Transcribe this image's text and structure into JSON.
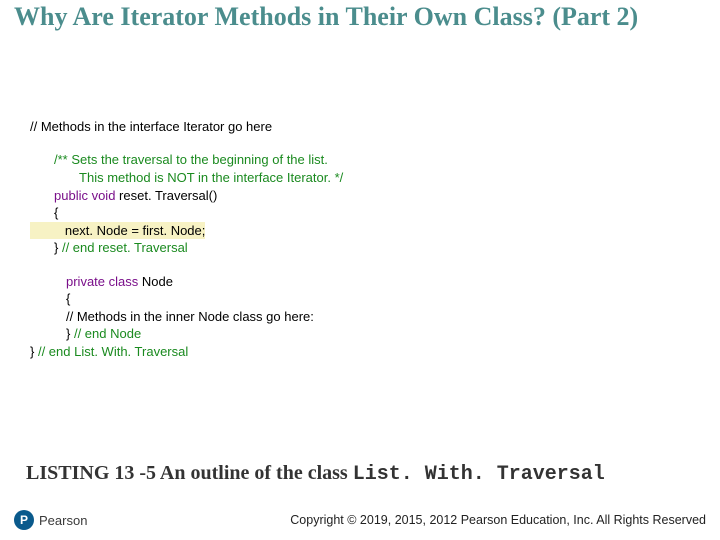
{
  "title": "Why Are Iterator Methods in Their Own Class? (Part 2)",
  "code": {
    "l1": "// Methods in the interface Iterator go here",
    "l2a": "/** Sets the traversal to the beginning of the list.",
    "l2b": "       This method is NOT in the interface Iterator. */",
    "l3_kw": "public void",
    "l3_rest": " reset. Traversal()",
    "l4": "{",
    "l5": "   next. Node = first. Node;",
    "l6a": "} ",
    "l6b": "// end reset. Traversal",
    "l7_kw": "private class",
    "l7_rest": " Node",
    "l8": "{",
    "l9": "// Methods in the inner Node class go here:",
    "l10a": "} ",
    "l10b": "// end Node",
    "l11a": "} ",
    "l11b": "// end List. With. Traversal"
  },
  "listing_prefix": "LISTING 13 -5 An outline of the class ",
  "listing_class": "List. With. Traversal",
  "logo_letter": "P",
  "logo_name": "Pearson",
  "copyright": "Copyright © 2019, 2015, 2012 Pearson Education, Inc. All Rights Reserved"
}
